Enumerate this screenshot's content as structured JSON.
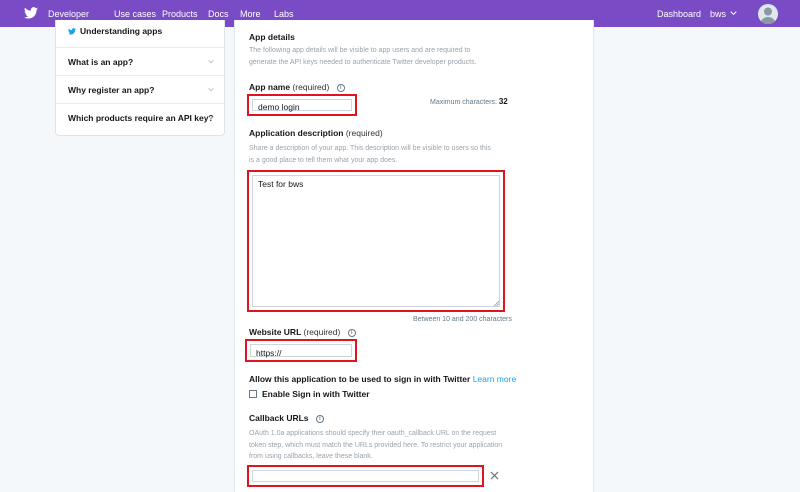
{
  "nav": {
    "brand": "Developer",
    "links": [
      "Use cases",
      "Products",
      "Docs",
      "More",
      "Labs"
    ],
    "dashboard": "Dashboard",
    "user": "bws"
  },
  "faq": {
    "top_label": "Understanding apps",
    "items": [
      "What is an app?",
      "Why register an app?",
      "Which products require an API key?"
    ]
  },
  "form": {
    "section_title": "App details",
    "section_desc": "The following app details will be visible to app users and are required to generate the API keys needed to authenticate Twitter developer products.",
    "app_name": {
      "label": "App name",
      "req": "(required)",
      "value": "demo login",
      "max_label": "Maximum characters:",
      "max_value": "32"
    },
    "description": {
      "label": "Application description",
      "req": "(required)",
      "help": "Share a description of your app. This description will be visible to users so this is a good place to tell them what your app does.",
      "value": "Test for bws",
      "limit": "Between 10 and 200 characters"
    },
    "website": {
      "label": "Website URL",
      "req": "(required)",
      "value": "https://"
    },
    "signin": {
      "label": "Allow this application to be used to sign in with Twitter",
      "learn_more": "Learn more",
      "checkbox_label": "Enable Sign in with Twitter",
      "checked": false
    },
    "callback": {
      "label": "Callback URLs",
      "help": "OAuth 1.0a applications should specify their oauth_callback URL on the request token step, which must match the URLs provided here. To restrict your application from using callbacks, leave these blank.",
      "value": ""
    }
  },
  "colors": {
    "nav_bg": "#794bc4",
    "highlight": "#e0141e",
    "link": "#1da1f2"
  }
}
